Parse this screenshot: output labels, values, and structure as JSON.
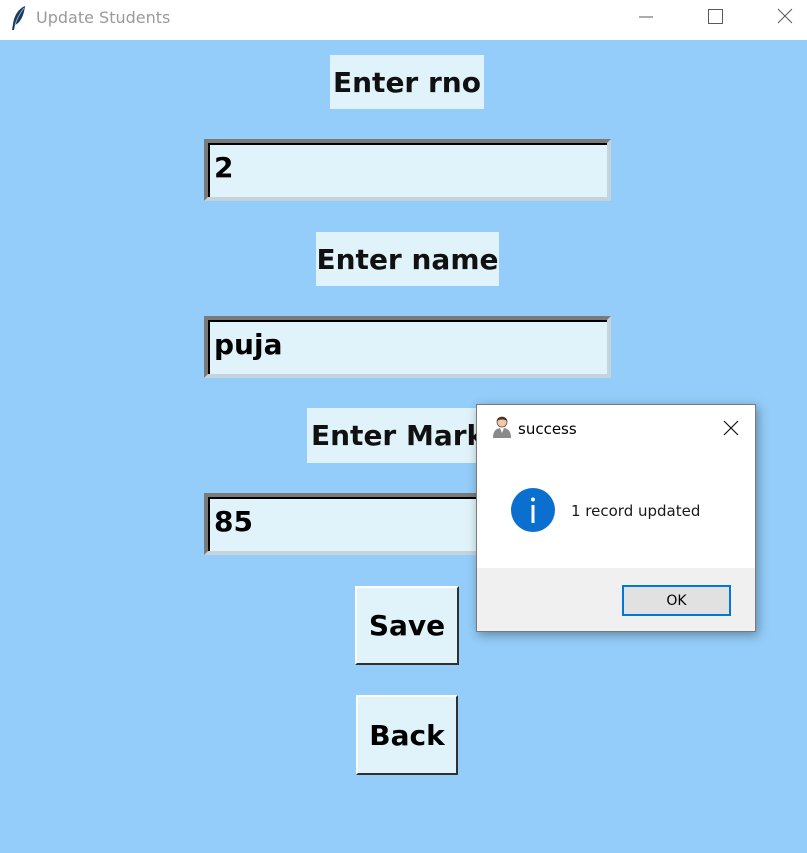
{
  "window": {
    "title": "Update Students",
    "app_icon": "feather-icon"
  },
  "form": {
    "rno_label": "Enter rno",
    "rno_value": "2",
    "name_label": "Enter name",
    "name_value": "puja",
    "marks_label": "Enter Marks",
    "marks_value": "85",
    "save_label": "Save",
    "back_label": "Back"
  },
  "dialog": {
    "title": "success",
    "message": "1 record updated",
    "ok_label": "OK",
    "icon": "info-icon",
    "title_icon": "user-icon"
  },
  "colors": {
    "background": "#94cdf9",
    "field": "#e0f3fa",
    "info_blue": "#0a6fcf",
    "focus_blue": "#0078d7"
  }
}
